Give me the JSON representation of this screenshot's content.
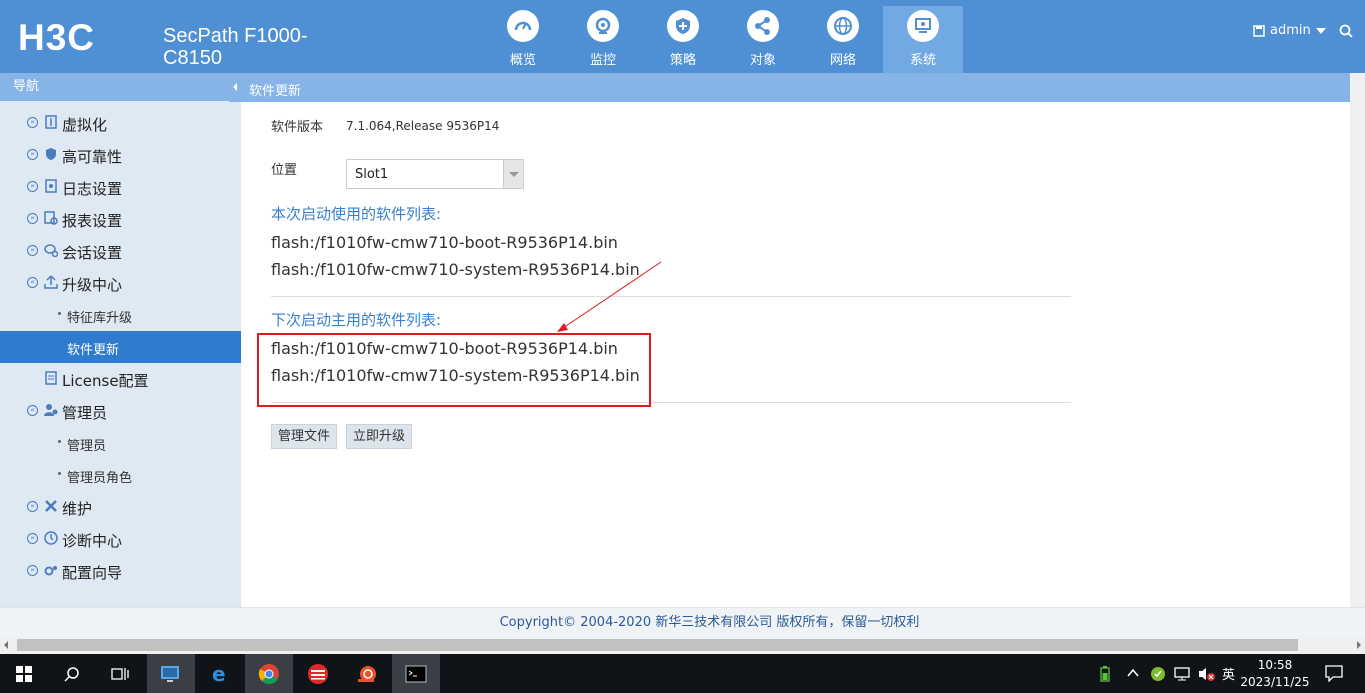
{
  "header": {
    "logo": "H3C",
    "product": "SecPath F1000-C8150",
    "nav": [
      {
        "label": "概览",
        "icon": "dashboard-icon"
      },
      {
        "label": "监控",
        "icon": "monitor-icon"
      },
      {
        "label": "策略",
        "icon": "shield-plus-icon"
      },
      {
        "label": "对象",
        "icon": "share-icon"
      },
      {
        "label": "网络",
        "icon": "globe-icon"
      },
      {
        "label": "系统",
        "icon": "system-icon",
        "active": true
      }
    ],
    "user": "admin"
  },
  "sidebar": {
    "title": "导航",
    "items": [
      {
        "label": "虚拟化"
      },
      {
        "label": "高可靠性"
      },
      {
        "label": "日志设置"
      },
      {
        "label": "报表设置"
      },
      {
        "label": "会话设置"
      },
      {
        "label": "升级中心"
      },
      {
        "label": "特征库升级"
      },
      {
        "label": "软件更新"
      },
      {
        "label": "License配置"
      },
      {
        "label": "管理员"
      },
      {
        "label": "管理员"
      },
      {
        "label": "管理员角色"
      },
      {
        "label": "维护"
      },
      {
        "label": "诊断中心"
      },
      {
        "label": "配置向导"
      }
    ]
  },
  "tab": {
    "label": "软件更新"
  },
  "content": {
    "version_label": "软件版本",
    "version_value": "7.1.064,Release 9536P14",
    "location_label": "位置",
    "location_value": "Slot1",
    "current_title": "本次启动使用的软件列表:",
    "current_files": [
      "flash:/f1010fw-cmw710-boot-R9536P14.bin",
      "flash:/f1010fw-cmw710-system-R9536P14.bin"
    ],
    "next_title": "下次启动主用的软件列表:",
    "next_files": [
      "flash:/f1010fw-cmw710-boot-R9536P14.bin",
      "flash:/f1010fw-cmw710-system-R9536P14.bin"
    ],
    "manage_button": "管理文件",
    "upgrade_button": "立即升级"
  },
  "footer": {
    "copyright": "Copyright© 2004-2020 新华三技术有限公司 版权所有，保留一切权利"
  },
  "taskbar": {
    "ime": "英",
    "time": "10:58",
    "date": "2023/11/25"
  },
  "colors": {
    "header": "#4f8fd3",
    "highlight": "#e11b1b",
    "active_menu": "#2f7bcf"
  }
}
